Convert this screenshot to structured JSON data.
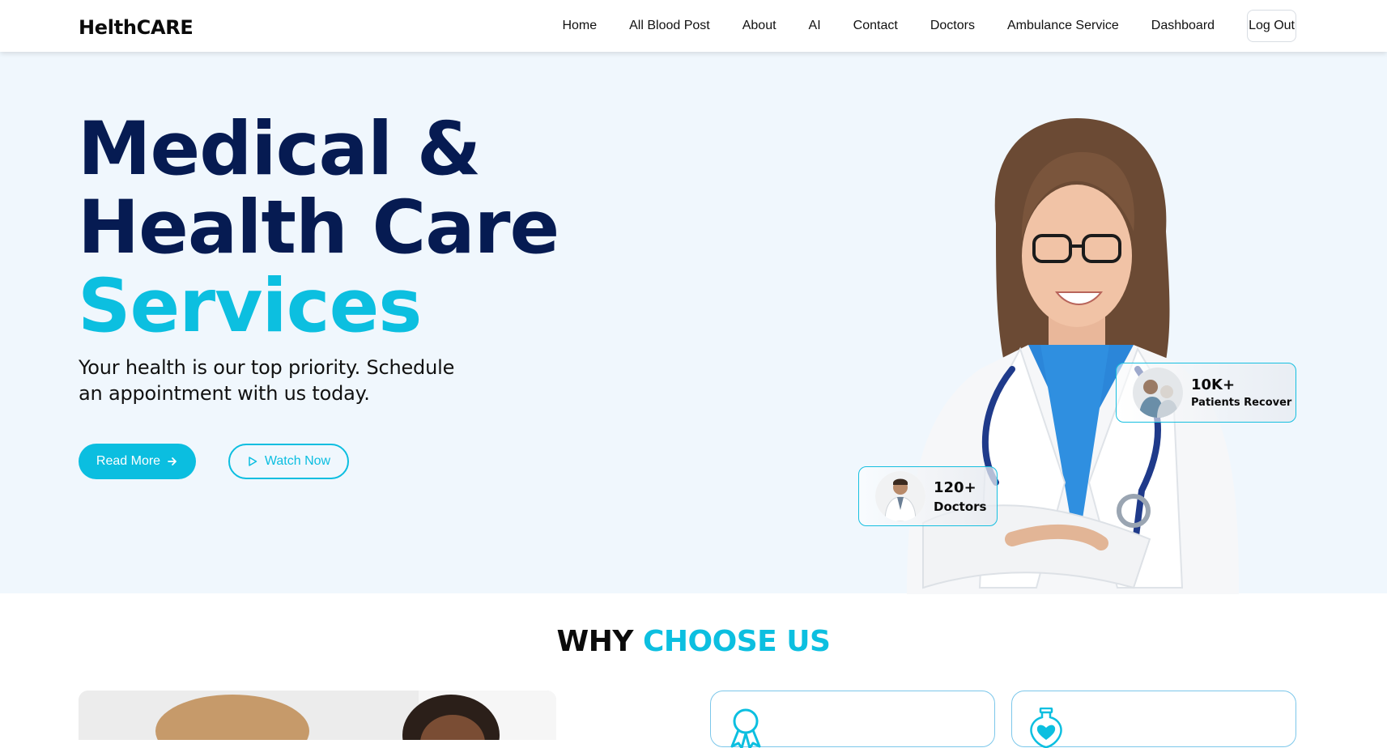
{
  "navbar": {
    "brand": "HelthCARE",
    "links": [
      "Home",
      "All Blood Post",
      "About",
      "AI",
      "Contact",
      "Doctors",
      "Ambulance Service",
      "Dashboard"
    ],
    "logout_label": "Log Out"
  },
  "hero": {
    "title_line1": "Medical &",
    "title_line2": "Health Care",
    "title_line3": "Services",
    "subtitle": "Your health is our top priority. Schedule an appointment with us today.",
    "read_more_label": "Read More",
    "watch_now_label": "Watch Now",
    "stats": {
      "patients": {
        "value": "10K+",
        "label": "Patients Recover"
      },
      "doctors": {
        "value": "120+",
        "label": "Doctors"
      }
    }
  },
  "why": {
    "title_part1": "WHY",
    "title_part2": "CHOOSE US"
  },
  "colors": {
    "accent": "#0cbfe0",
    "title_navy": "#061b52",
    "hero_bg": "#f0f7fd"
  },
  "icons": [
    "arrow-right-icon",
    "play-icon",
    "award-icon",
    "heart-bottle-icon"
  ]
}
